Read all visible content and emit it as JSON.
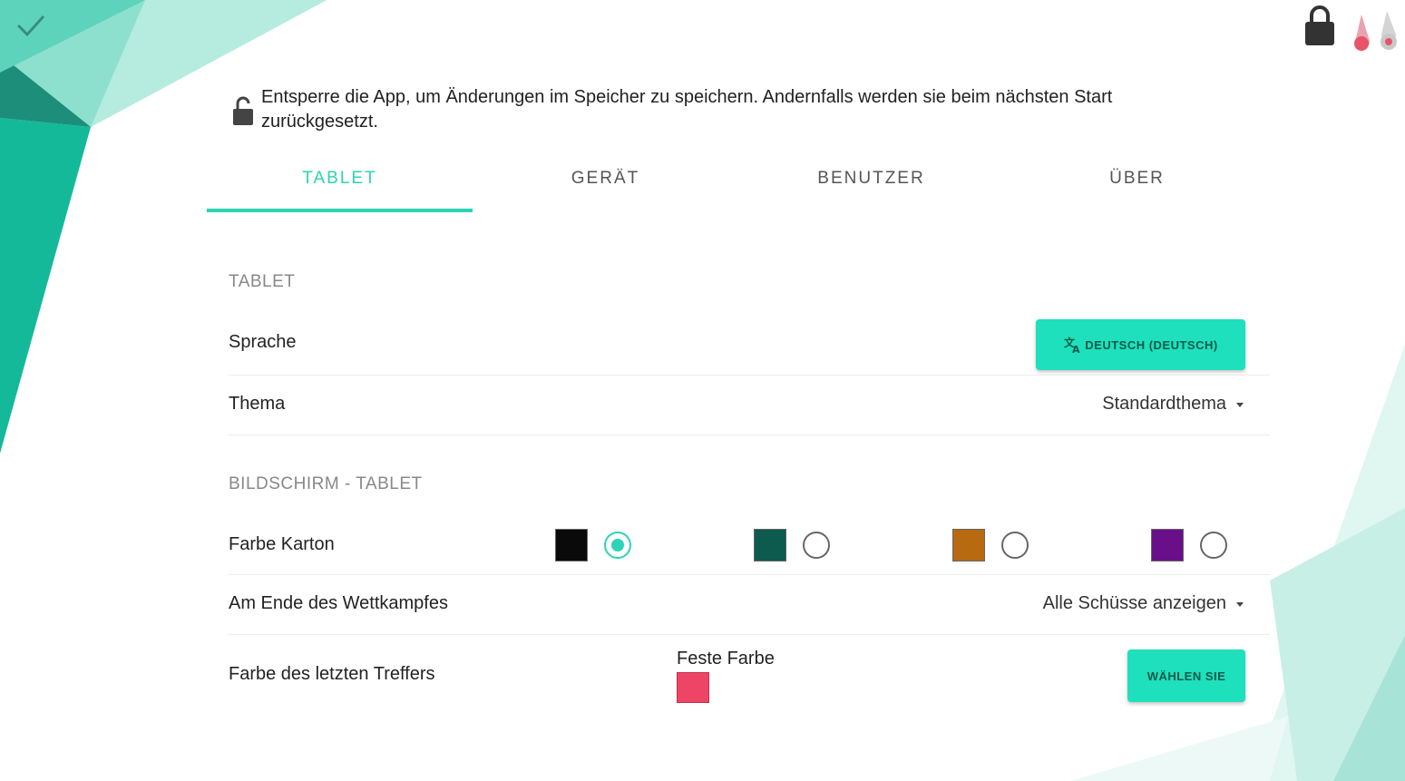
{
  "colors": {
    "accent": "#2bd4b4",
    "button_bg": "#1ee0bc",
    "last_hit_color": "#ee4466"
  },
  "topbar": {
    "confirm_icon": "check-icon",
    "lock_icon": "lock-icon",
    "device_icon": "pins-icon"
  },
  "notice": {
    "icon": "unlocked-lock-icon",
    "text": "Entsperre die App, um Änderungen im Speicher zu speichern. Andernfalls werden sie beim nächsten Start zurückgesetzt."
  },
  "tabs": [
    {
      "label": "TABLET",
      "active": true
    },
    {
      "label": "GERÄT",
      "active": false
    },
    {
      "label": "BENUTZER",
      "active": false
    },
    {
      "label": "ÜBER",
      "active": false
    }
  ],
  "tablet_section": {
    "title": "TABLET",
    "language": {
      "label": "Sprache",
      "button": "DEUTSCH (DEUTSCH)",
      "icon": "translate-icon"
    },
    "theme": {
      "label": "Thema",
      "value": "Standardthema"
    }
  },
  "screen_section": {
    "title": "BILDSCHIRM - TABLET",
    "card_color": {
      "label": "Farbe Karton",
      "options": [
        {
          "color": "#0a0a0a",
          "selected": true
        },
        {
          "color": "#0d5a4e",
          "selected": false
        },
        {
          "color": "#b86a10",
          "selected": false
        },
        {
          "color": "#6a0f8a",
          "selected": false
        }
      ]
    },
    "competition_end": {
      "label": "Am Ende des Wettkampfes",
      "value": "Alle Schüsse anzeigen"
    },
    "last_hit": {
      "label": "Farbe des letzten Treffers",
      "fixed_label": "Feste Farbe",
      "button": "WÄHLEN SIE"
    }
  }
}
